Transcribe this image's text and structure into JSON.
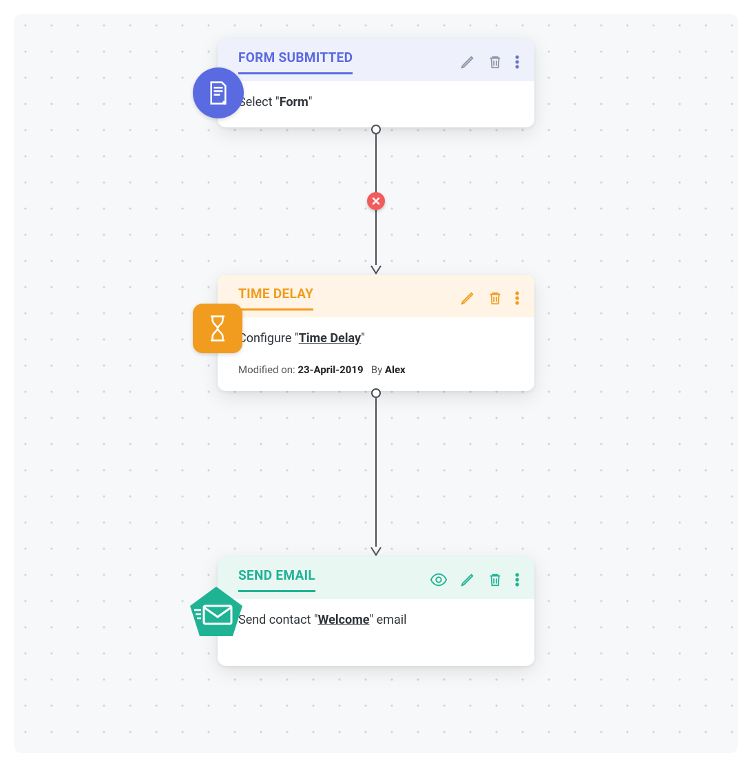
{
  "nodes": {
    "form": {
      "title": "FORM SUBMITTED",
      "body_prefix": "Select \"",
      "body_strong": "Form",
      "body_suffix": "\""
    },
    "delay": {
      "title": "TIME DELAY",
      "body_prefix": "Configure \"",
      "body_link": "Time Delay",
      "body_suffix": "\"",
      "modified_label": "Modified on: ",
      "modified_date": "23-April-2019",
      "by_label": "   By ",
      "by_value": "Alex"
    },
    "email": {
      "title": "SEND EMAIL",
      "body_prefix": "Send contact \"",
      "body_link": "Welcome",
      "body_suffix": "\" email"
    }
  },
  "colors": {
    "form": "#5A6AE0",
    "delay": "#F19C1F",
    "email": "#1FB394",
    "delete": "#F15B5B"
  }
}
